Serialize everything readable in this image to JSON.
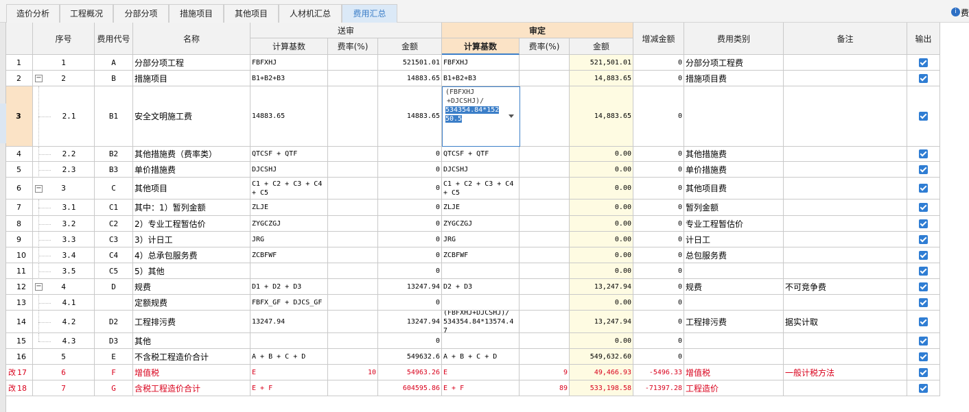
{
  "tabs": [
    {
      "label": "造价分析",
      "active": false
    },
    {
      "label": "工程概况",
      "active": false
    },
    {
      "label": "分部分项",
      "active": false
    },
    {
      "label": "措施项目",
      "active": false
    },
    {
      "label": "其他项目",
      "active": false
    },
    {
      "label": "人材机汇总",
      "active": false
    },
    {
      "label": "费用汇总",
      "active": true
    }
  ],
  "right_extra_label": "费",
  "right_extra_icon": "info-circle-icon",
  "header": {
    "seq": "序号",
    "code": "费用代号",
    "name": "名称",
    "songshen": "送审",
    "shending": "审定",
    "ss_base": "计算基数",
    "ss_rate": "费率(%)",
    "ss_amount": "金额",
    "sd_base": "计算基数",
    "sd_rate": "费率(%)",
    "sd_amount": "金额",
    "diff": "增减金额",
    "category": "费用类别",
    "remark": "备注",
    "output": "输出"
  },
  "rows": [
    {
      "idx": "1",
      "mark": "",
      "seq": "1",
      "code": "A",
      "name": "分部分项工程",
      "ss_base": "FBFXHJ",
      "ss_rate": "",
      "ss_amount": "521501.01",
      "sd_base": "FBFXHJ",
      "sd_rate": "",
      "sd_amount": "521,501.01",
      "diff": "0",
      "category": "分部分项工程费",
      "remark": "",
      "output": true,
      "red": false,
      "level": 0,
      "toggle": false
    },
    {
      "idx": "2",
      "mark": "",
      "seq": "2",
      "code": "B",
      "name": "措施项目",
      "ss_base": "B1+B2+B3",
      "ss_rate": "",
      "ss_amount": "14883.65",
      "sd_base": "B1+B2+B3",
      "sd_rate": "",
      "sd_amount": "14,883.65",
      "diff": "0",
      "category": "措施项目费",
      "remark": "",
      "output": true,
      "red": false,
      "level": 0,
      "toggle": true
    },
    {
      "idx": "3",
      "mark": "",
      "seq": "2.1",
      "code": "B1",
      "name": "安全文明施工费",
      "ss_base": "14883.65",
      "ss_rate": "",
      "ss_amount": "14883.65",
      "sd_base": "",
      "sd_rate": "",
      "sd_amount": "14,883.65",
      "diff": "0",
      "category": "",
      "remark": "",
      "output": true,
      "red": false,
      "level": 1,
      "toggle": false,
      "selected": true
    },
    {
      "idx": "4",
      "mark": "",
      "seq": "2.2",
      "code": "B2",
      "name": "其他措施费（费率类）",
      "ss_base": "QTCSF + QTF",
      "ss_rate": "",
      "ss_amount": "0",
      "sd_base": "QTCSF + QTF",
      "sd_rate": "",
      "sd_amount": "0.00",
      "diff": "0",
      "category": "其他措施费",
      "remark": "",
      "output": true,
      "red": false,
      "level": 1,
      "toggle": false
    },
    {
      "idx": "5",
      "mark": "",
      "seq": "2.3",
      "code": "B3",
      "name": "单价措施费",
      "ss_base": "DJCSHJ",
      "ss_rate": "",
      "ss_amount": "0",
      "sd_base": "DJCSHJ",
      "sd_rate": "",
      "sd_amount": "0.00",
      "diff": "0",
      "category": "单价措施费",
      "remark": "",
      "output": true,
      "red": false,
      "level": 1,
      "toggle": false
    },
    {
      "idx": "6",
      "mark": "",
      "seq": "3",
      "code": "C",
      "name": "其他项目",
      "ss_base": "C1 + C2 + C3 + C4 + C5",
      "ss_rate": "",
      "ss_amount": "0",
      "sd_base": "C1 + C2 + C3 + C4 + C5",
      "sd_rate": "",
      "sd_amount": "0.00",
      "diff": "0",
      "category": "其他项目费",
      "remark": "",
      "output": true,
      "red": false,
      "level": 0,
      "toggle": true
    },
    {
      "idx": "7",
      "mark": "",
      "seq": "3.1",
      "code": "C1",
      "name": "其中：1）暂列金额",
      "ss_base": "ZLJE",
      "ss_rate": "",
      "ss_amount": "0",
      "sd_base": "ZLJE",
      "sd_rate": "",
      "sd_amount": "0.00",
      "diff": "0",
      "category": "暂列金额",
      "remark": "",
      "output": true,
      "red": false,
      "level": 1,
      "toggle": false
    },
    {
      "idx": "8",
      "mark": "",
      "seq": "3.2",
      "code": "C2",
      "name": "2）专业工程暂估价",
      "ss_base": "ZYGCZGJ",
      "ss_rate": "",
      "ss_amount": "0",
      "sd_base": "ZYGCZGJ",
      "sd_rate": "",
      "sd_amount": "0.00",
      "diff": "0",
      "category": "专业工程暂估价",
      "remark": "",
      "output": true,
      "red": false,
      "level": 1,
      "toggle": false
    },
    {
      "idx": "9",
      "mark": "",
      "seq": "3.3",
      "code": "C3",
      "name": "3）计日工",
      "ss_base": "JRG",
      "ss_rate": "",
      "ss_amount": "0",
      "sd_base": "JRG",
      "sd_rate": "",
      "sd_amount": "0.00",
      "diff": "0",
      "category": "计日工",
      "remark": "",
      "output": true,
      "red": false,
      "level": 1,
      "toggle": false
    },
    {
      "idx": "10",
      "mark": "",
      "seq": "3.4",
      "code": "C4",
      "name": "4）总承包服务费",
      "ss_base": "ZCBFWF",
      "ss_rate": "",
      "ss_amount": "0",
      "sd_base": "ZCBFWF",
      "sd_rate": "",
      "sd_amount": "0.00",
      "diff": "0",
      "category": "总包服务费",
      "remark": "",
      "output": true,
      "red": false,
      "level": 1,
      "toggle": false
    },
    {
      "idx": "11",
      "mark": "",
      "seq": "3.5",
      "code": "C5",
      "name": "5）其他",
      "ss_base": "",
      "ss_rate": "",
      "ss_amount": "0",
      "sd_base": "",
      "sd_rate": "",
      "sd_amount": "0.00",
      "diff": "0",
      "category": "",
      "remark": "",
      "output": true,
      "red": false,
      "level": 1,
      "toggle": false
    },
    {
      "idx": "12",
      "mark": "",
      "seq": "4",
      "code": "D",
      "name": "规费",
      "ss_base": "D1 + D2 + D3",
      "ss_rate": "",
      "ss_amount": "13247.94",
      "sd_base": "D2 + D3",
      "sd_rate": "",
      "sd_amount": "13,247.94",
      "diff": "0",
      "category": "规费",
      "remark": "不可竞争费",
      "output": true,
      "red": false,
      "level": 0,
      "toggle": true
    },
    {
      "idx": "13",
      "mark": "",
      "seq": "4.1",
      "code": "",
      "name": "定额规费",
      "ss_base": "FBFX_GF + DJCS_GF",
      "ss_rate": "",
      "ss_amount": "0",
      "sd_base": "",
      "sd_rate": "",
      "sd_amount": "0.00",
      "diff": "0",
      "category": "",
      "remark": "",
      "output": true,
      "red": false,
      "level": 1,
      "toggle": false
    },
    {
      "idx": "14",
      "mark": "",
      "seq": "4.2",
      "code": "D2",
      "name": "工程排污费",
      "ss_base": "13247.94",
      "ss_rate": "",
      "ss_amount": "13247.94",
      "sd_base": "(FBFXHJ+DJCSHJ)/ 534354.84*13574.47",
      "sd_rate": "",
      "sd_amount": "13,247.94",
      "diff": "0",
      "category": "工程排污费",
      "remark": "据实计取",
      "output": true,
      "red": false,
      "level": 1,
      "toggle": false
    },
    {
      "idx": "15",
      "mark": "",
      "seq": "4.3",
      "code": "D3",
      "name": "其他",
      "ss_base": "",
      "ss_rate": "",
      "ss_amount": "0",
      "sd_base": "",
      "sd_rate": "",
      "sd_amount": "0.00",
      "diff": "0",
      "category": "",
      "remark": "",
      "output": true,
      "red": false,
      "level": 1,
      "toggle": false,
      "last_child": true
    },
    {
      "idx": "16",
      "mark": "",
      "seq": "5",
      "code": "E",
      "name": "不含税工程造价合计",
      "ss_base": "A + B + C + D",
      "ss_rate": "",
      "ss_amount": "549632.6",
      "sd_base": "A + B + C + D",
      "sd_rate": "",
      "sd_amount": "549,632.60",
      "diff": "0",
      "category": "",
      "remark": "",
      "output": true,
      "red": false,
      "level": 0,
      "toggle": false
    },
    {
      "idx": "17",
      "mark": "改",
      "seq": "6",
      "code": "F",
      "name": "增值税",
      "ss_base": "E",
      "ss_rate": "10",
      "ss_amount": "54963.26",
      "sd_base": "E",
      "sd_rate": "9",
      "sd_amount": "49,466.93",
      "diff": "-5496.33",
      "category": "增值税",
      "remark": "一般计税方法",
      "output": true,
      "red": true,
      "level": 0,
      "toggle": false
    },
    {
      "idx": "18",
      "mark": "改",
      "seq": "7",
      "code": "G",
      "name": "含税工程造价合计",
      "ss_base": "E + F",
      "ss_rate": "",
      "ss_amount": "604595.86",
      "sd_base": "E + F",
      "sd_rate": "89",
      "sd_amount": "533,198.58",
      "diff": "-71397.28",
      "category": "工程造价",
      "remark": "",
      "output": true,
      "red": true,
      "level": 0,
      "toggle": false
    }
  ],
  "editor": {
    "line1": "(FBFXHJ",
    "line2": "+DJCSHJ)/",
    "line3": "534354.84*152",
    "line4": "50.5"
  }
}
